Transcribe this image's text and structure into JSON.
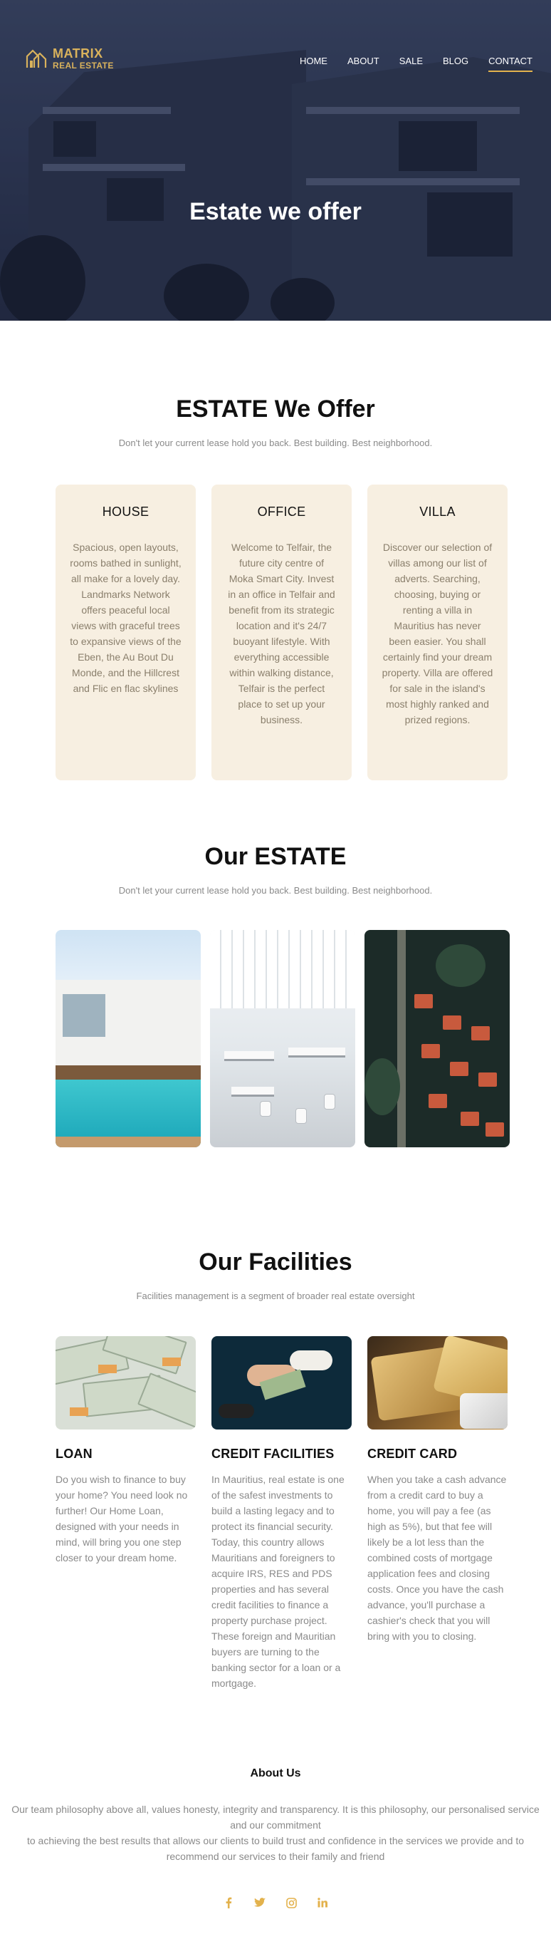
{
  "brand": {
    "line1": "MATRIX",
    "line2": "REAL ESTATE",
    "color": "#d9b25c"
  },
  "nav": {
    "items": [
      {
        "label": "HOME"
      },
      {
        "label": "ABOUT"
      },
      {
        "label": "SALE"
      },
      {
        "label": "BLOG"
      },
      {
        "label": "CONTACT",
        "active": true
      }
    ],
    "accent": "#e3b24d"
  },
  "hero": {
    "title": "Estate we offer"
  },
  "estate_offer": {
    "title": "ESTATE We Offer",
    "subtitle": "Don't let your current lease hold you back. Best building. Best neighborhood.",
    "cards": [
      {
        "title": "HOUSE",
        "text": "Spacious, open layouts, rooms bathed in sunlight, all make for a lovely day. Landmarks Network offers peaceful local views with graceful trees to expansive views of the Eben, the Au Bout Du Monde, and the Hillcrest and Flic en flac skylines"
      },
      {
        "title": "OFFICE",
        "text": "Welcome to Telfair, the future city centre of Moka Smart City. Invest in an office in Telfair and benefit from its strategic location and it's 24/7 buoyant lifestyle. With everything accessible within walking distance, Telfair is the perfect place to set up your business."
      },
      {
        "title": "VILLA",
        "text": "Discover our selection of villas among our list of adverts. Searching, choosing, buying or renting a villa in Mauritius has never been easier. You shall certainly find your dream property. Villa are offered for sale in the island's most highly ranked and prized regions."
      }
    ]
  },
  "our_estate": {
    "title": "Our ESTATE",
    "subtitle": "Don't let your current lease hold you back. Best building. Best neighborhood."
  },
  "facilities": {
    "title": "Our Facilities",
    "subtitle": "Facilities management is a segment of broader real estate oversight",
    "items": [
      {
        "title": "LOAN",
        "text": "Do you wish to finance to buy your home? You need look no further! Our Home Loan, designed with your needs in mind, will bring you one step closer to your dream home."
      },
      {
        "title": "CREDIT FACILITIES",
        "text": "In Mauritius, real estate is one of the safest investments to build a lasting legacy and to protect its financial security. Today, this country allows Mauritians and foreigners to acquire IRS, RES and PDS properties and has several credit facilities to finance a property purchase project. These foreign and Mauritian buyers are turning to the banking sector for a loan or a mortgage."
      },
      {
        "title": "CREDIT CARD",
        "text": "When you take a cash advance from a credit card to buy a home, you will pay a fee (as high as 5%), but that fee will likely be a lot less than the combined costs of mortgage application fees and closing costs. Once you have the cash advance, you'll purchase a cashier's check that you will bring with you to closing."
      }
    ]
  },
  "about": {
    "title": "About Us",
    "text1": "Our team philosophy above all, values honesty, integrity and transparency. It is this philosophy, our personalised service and our commitment",
    "text2": "to achieving the best results that allows our clients to build trust and confidence in the services we provide and to recommend our services to their family and friend"
  },
  "social": {
    "icons": [
      "facebook-icon",
      "twitter-icon",
      "instagram-icon",
      "linkedin-icon"
    ],
    "color": "#e3b24d"
  }
}
